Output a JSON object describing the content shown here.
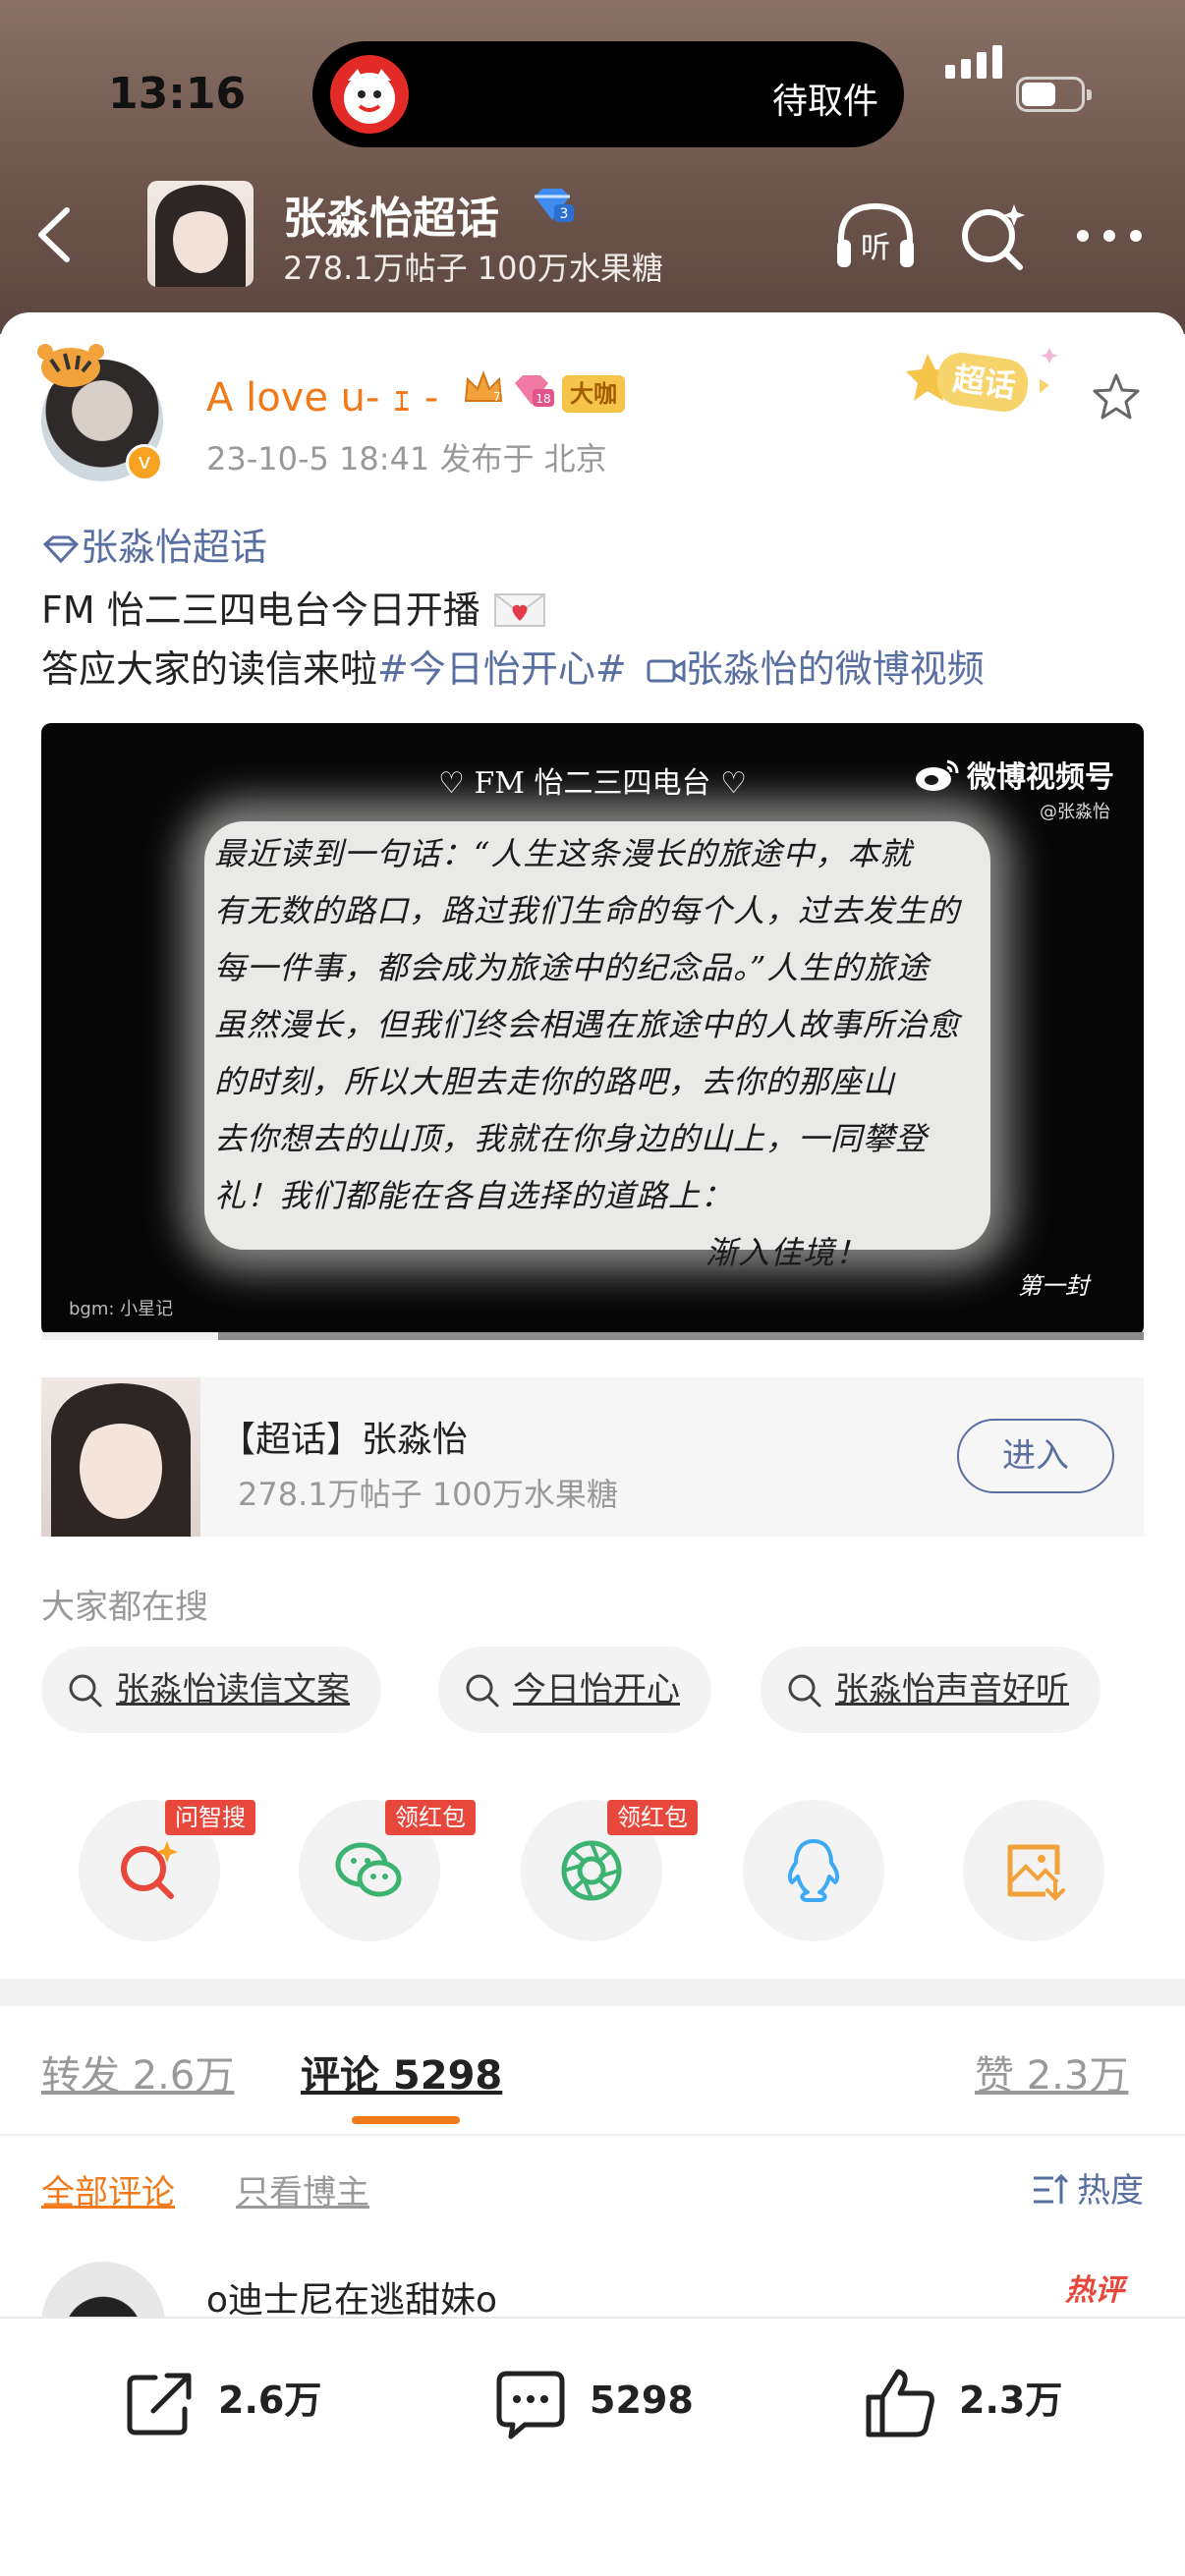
{
  "status_bar": {
    "time": "13:16",
    "island_text": "待取件"
  },
  "header": {
    "topic_title": "张淼怡超话",
    "topic_stats": "278.1万帖子 100万水果糖",
    "level_badge": "3"
  },
  "post": {
    "user_name": "A love u- ｪ -",
    "badge_dakai": "大咖",
    "level_badge": "18",
    "crown_level": "7",
    "meta": "23-10-5 18:41  发布于 北京",
    "chaohua_stamp": "超话",
    "topic_link": "张淼怡超话",
    "line1": "FM 怡二三四电台今日开播",
    "line2_text": "答应大家的读信来啦",
    "line2_hashtag": "#今日怡开心#",
    "line2_video_link": "张淼怡的微博视频"
  },
  "video": {
    "title": "♡ FM 怡二三四电台 ♡",
    "brand": "微博视频号",
    "by": "@张淼怡",
    "letter_lines": [
      "最近读到一句话：“人生这条漫长的旅途中，本就",
      "有无数的路口，路过我们生命的每个人，过去发生的",
      "每一件事，都会成为旅途中的纪念品。”人生的旅途",
      "虽然漫长，但我们终会相遇在旅途中的人故事所治愈",
      "的时刻，所以大胆去走你的路吧，去你的那座山",
      "去你想去的山顶，我就在你身边的山上，一同攀登",
      "礼！我们都能在各自选择的道路上：",
      "渐入佳境！"
    ],
    "bgm": "bgm: 小星记",
    "sign": "第一封",
    "progress": 0.16
  },
  "super_topic": {
    "title": "【超话】张淼怡",
    "stats": "278.1万帖子 100万水果糖",
    "enter_label": "进入"
  },
  "everyone_search": {
    "label": "大家都在搜",
    "chips": [
      "张淼怡读信文案",
      "今日怡开心",
      "张淼怡声音好听"
    ]
  },
  "share_row": {
    "tags": [
      "问智搜",
      "领红包",
      "领红包"
    ],
    "icons": [
      "ai-search-icon",
      "wechat-icon",
      "moments-icon",
      "qq-icon",
      "save-image-icon"
    ]
  },
  "tabs": {
    "repost": "转发 2.6万",
    "comment": "评论 5298",
    "like": "赞 2.3万"
  },
  "filters": {
    "all": "全部评论",
    "author_only": "只看博主",
    "sort": "热度"
  },
  "comment": {
    "user_name": "o迪士尼在逃甜妹o",
    "hot_badge": "热评"
  },
  "bottom_actions": {
    "repost": "2.6万",
    "comment": "5298",
    "like": "2.3万"
  },
  "colors": {
    "accent_orange": "#f07a1a",
    "link_blue": "#5a6fa1",
    "hot_red": "#e8473c",
    "header_brown": "#6e564d"
  }
}
